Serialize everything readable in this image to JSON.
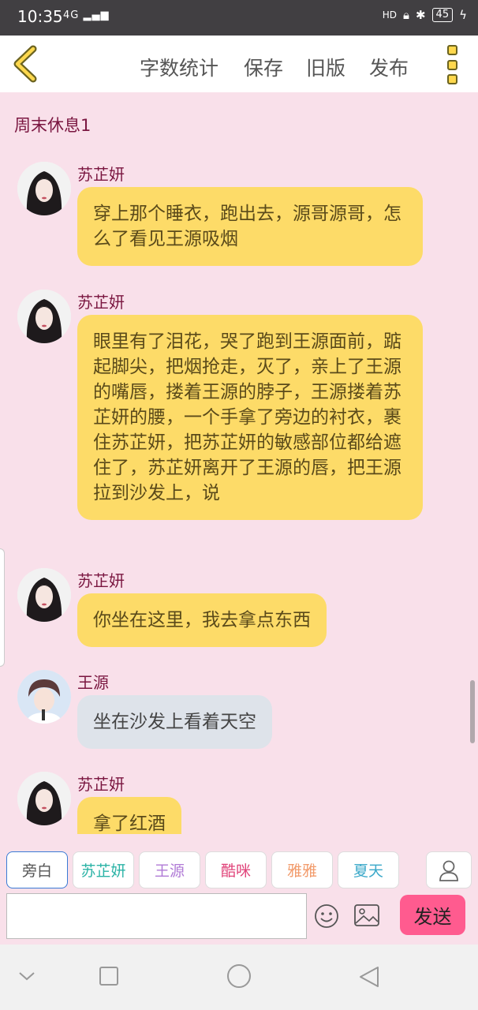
{
  "status_bar": {
    "time": "10:35",
    "signal": "4G",
    "hd": "HD",
    "battery": "45"
  },
  "header": {
    "actions": [
      "字数统计",
      "保存",
      "旧版",
      "发布"
    ]
  },
  "chat": {
    "title": "周末休息1",
    "messages": [
      {
        "sender": "苏芷妍",
        "text": "穿上那个睡衣，跑出去，源哥源哥，怎么了看见王源吸烟",
        "style": "yellow"
      },
      {
        "sender": "苏芷妍",
        "text": "眼里有了泪花，哭了跑到王源面前，踮起脚尖，把烟抢走，灭了，亲上了王源的嘴唇，搂着王源的脖子，王源搂着苏芷妍的腰，一个手拿了旁边的衬衣，裹住苏芷妍，把苏芷妍的敏感部位都给遮住了，苏芷妍离开了王源的唇，把王源拉到沙发上，说",
        "style": "yellow"
      },
      {
        "sender": "苏芷妍",
        "text": "你坐在这里，我去拿点东西",
        "style": "yellow"
      },
      {
        "sender": "王源",
        "text": "坐在沙发上看着天空",
        "style": "gray"
      },
      {
        "sender": "苏芷妍",
        "text": "拿了红酒",
        "style": "yellow"
      }
    ]
  },
  "roles": [
    {
      "label": "旁白",
      "color": "#555555"
    },
    {
      "label": "苏芷妍",
      "color": "#2bb3a6"
    },
    {
      "label": "王源",
      "color": "#b07ad6"
    },
    {
      "label": "酷咪",
      "color": "#e0447a"
    },
    {
      "label": "雅雅",
      "color": "#f29b6b"
    },
    {
      "label": "夏天",
      "color": "#3aa8c9"
    }
  ],
  "composer": {
    "input_value": "",
    "send_label": "发送"
  },
  "colors": {
    "accent": "#ffd84d",
    "bubble_yellow": "#fddb68",
    "bubble_gray": "#dee3ea",
    "send": "#ff5b8f",
    "background": "#f9e0ea"
  }
}
